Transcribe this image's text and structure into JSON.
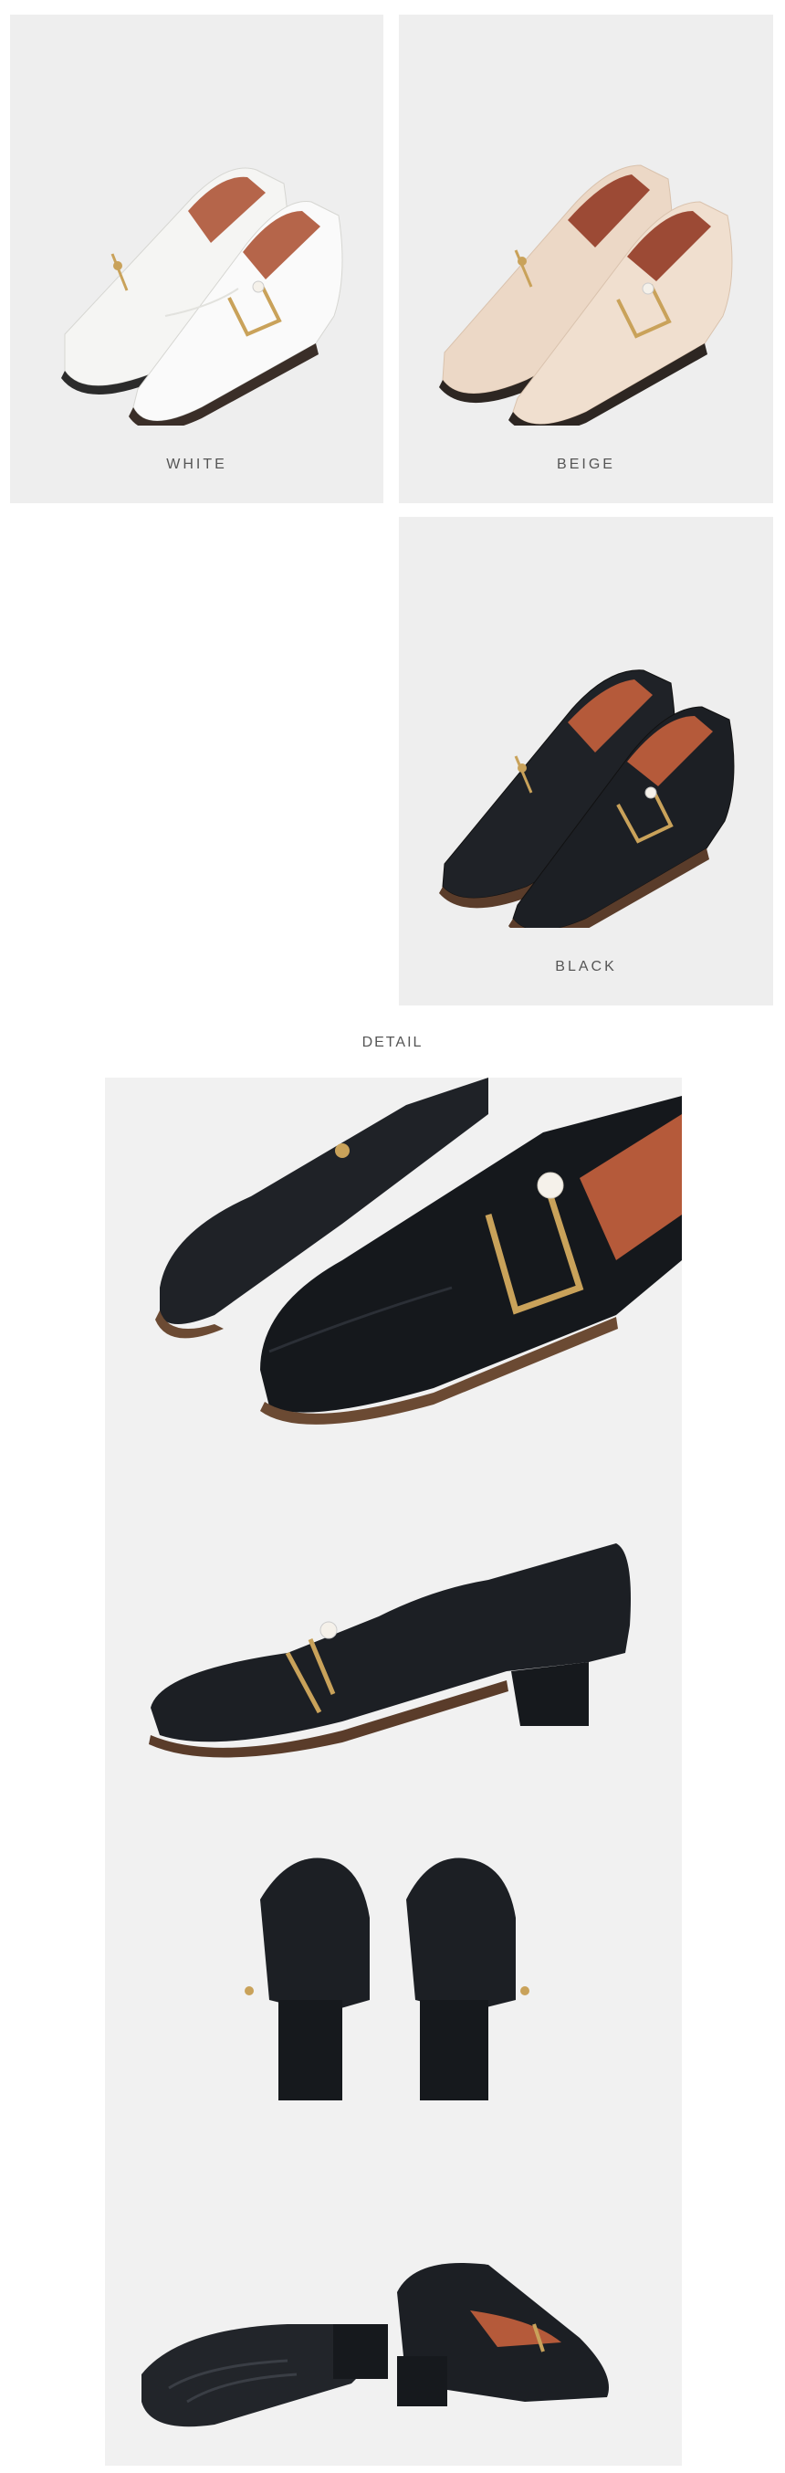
{
  "colors": {
    "tile_background": "#eeeeee",
    "detail_background": "#f1f1f1",
    "white_shoe": "#f7f7f5",
    "beige_shoe": "#efdccb",
    "black_shoe": "#1c1f24",
    "lining": "#b55a3a",
    "hardware": "#c9a25a",
    "pearl": "#f5f1ea"
  },
  "variants": [
    {
      "label": "WHITE"
    },
    {
      "label": "BEIGE"
    },
    {
      "label": "BLACK"
    }
  ],
  "detail": {
    "heading": "DETAIL"
  }
}
